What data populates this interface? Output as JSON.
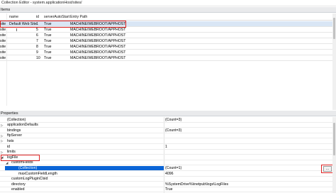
{
  "window": {
    "title": "Collection Editor - system.applicationHost/sites/"
  },
  "items_section": {
    "title": "Items"
  },
  "columns": {
    "site": "",
    "name": "name",
    "id": "id",
    "auto": "serverAutoStart",
    "path": "Entry Path"
  },
  "rows": [
    {
      "site": "site",
      "name": "Default Web Site",
      "id": "1",
      "auto": "True",
      "path": "MACHINE/WEBROOT/APPHOST"
    },
    {
      "site": "site",
      "name": "",
      "id": "5",
      "auto": "True",
      "path": "MACHINE/WEBROOT/APPHOST"
    },
    {
      "site": "site",
      "name": "",
      "id": "6",
      "auto": "True",
      "path": "MACHINE/WEBROOT/APPHOST"
    },
    {
      "site": "site",
      "name": "",
      "id": "7",
      "auto": "True",
      "path": "MACHINE/WEBROOT/APPHOST"
    },
    {
      "site": "site",
      "name": "",
      "id": "8",
      "auto": "True",
      "path": "MACHINE/WEBROOT/APPHOST"
    },
    {
      "site": "site",
      "name": "",
      "id": "9",
      "auto": "True",
      "path": "MACHINE/WEBROOT/APPHOST"
    },
    {
      "site": "site",
      "name": "",
      "id": "10",
      "auto": "True",
      "path": "MACHINE/WEBROOT/APPHOST"
    }
  ],
  "properties_section": {
    "title": "Properties"
  },
  "properties": [
    {
      "exp": "",
      "name": "(Collection)",
      "value": "(Count=3)"
    },
    {
      "exp": "▷",
      "name": "applicationDefaults",
      "value": ""
    },
    {
      "exp": "",
      "name": "bindings",
      "value": "(Count=3)"
    },
    {
      "exp": "▷",
      "name": "ftpServer",
      "value": ""
    },
    {
      "exp": "▷",
      "name": "hsts",
      "value": ""
    },
    {
      "exp": "",
      "name": "id",
      "value": "1"
    },
    {
      "exp": "▷",
      "name": "limits",
      "value": ""
    },
    {
      "exp": "◢",
      "name": "logFile",
      "value": ""
    },
    {
      "exp": "◢",
      "name": "customFields",
      "value": ""
    },
    {
      "exp": "",
      "name": "(Collection)",
      "value": "(Count=1)"
    },
    {
      "exp": "",
      "name": "maxCustomFieldLength",
      "value": "4096"
    },
    {
      "exp": "",
      "name": "customLogPluginClsid",
      "value": ""
    },
    {
      "exp": "",
      "name": "directory",
      "value": "%SystemDrive%\\inetpub\\logs\\LogFiles"
    },
    {
      "exp": "",
      "name": "enabled",
      "value": "True"
    }
  ],
  "ellipsis_label": "...",
  "accent_colors": {
    "selection": "#0a64d6",
    "highlight_box": "#dd2222"
  }
}
